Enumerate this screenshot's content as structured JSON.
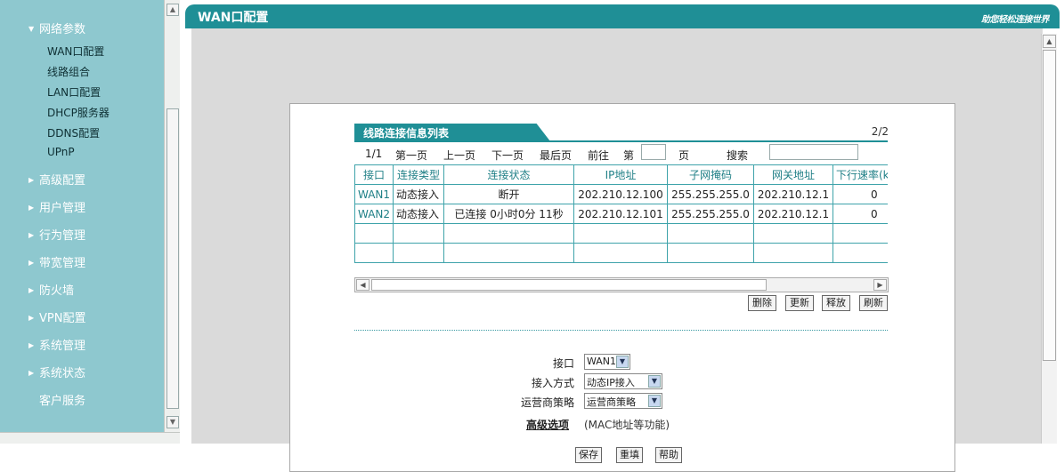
{
  "sidebar": {
    "section": "网络参数",
    "sub_items": [
      "WAN口配置",
      "线路组合",
      "LAN口配置",
      "DHCP服务器",
      "DDNS配置",
      "UPnP"
    ],
    "items": [
      "高级配置",
      "用户管理",
      "行为管理",
      "带宽管理",
      "防火墙",
      "VPN配置",
      "系统管理",
      "系统状态"
    ],
    "service": "客户服务"
  },
  "header": {
    "title": "WAN口配置",
    "slogan": "助您轻松连接世界"
  },
  "list": {
    "title": "线路连接信息列表",
    "page_count": "2/2",
    "pager": {
      "current": "1/1",
      "first": "第一页",
      "prev": "上一页",
      "next": "下一页",
      "last": "最后页",
      "goto": "前往",
      "di": "第",
      "ye": "页",
      "search": "搜索"
    },
    "columns": [
      "接口",
      "连接类型",
      "连接状态",
      "IP地址",
      "子网掩码",
      "网关地址",
      "下行速率(k"
    ],
    "rows": [
      [
        "WAN1",
        "动态接入",
        "断开",
        "202.210.12.100",
        "255.255.255.0",
        "202.210.12.1",
        "0"
      ],
      [
        "WAN2",
        "动态接入",
        "已连接  0小时0分  11秒",
        "202.210.12.101",
        "255.255.255.0",
        "202.210.12.1",
        "0"
      ]
    ],
    "buttons": {
      "delete": "删除",
      "update": "更新",
      "release": "释放",
      "refresh": "刷新"
    }
  },
  "form": {
    "interface_label": "接口",
    "interface_value": "WAN1",
    "access_label": "接入方式",
    "access_value": "动态IP接入",
    "isp_label": "运营商策略",
    "isp_value": "运营商策略",
    "advanced_link": "高级选项",
    "advanced_desc": "(MAC地址等功能)"
  },
  "actions": {
    "save": "保存",
    "refill": "重填",
    "help": "帮助"
  },
  "colors": {
    "teal": "#1f8f96",
    "sidebar": "#8ec8cf"
  }
}
